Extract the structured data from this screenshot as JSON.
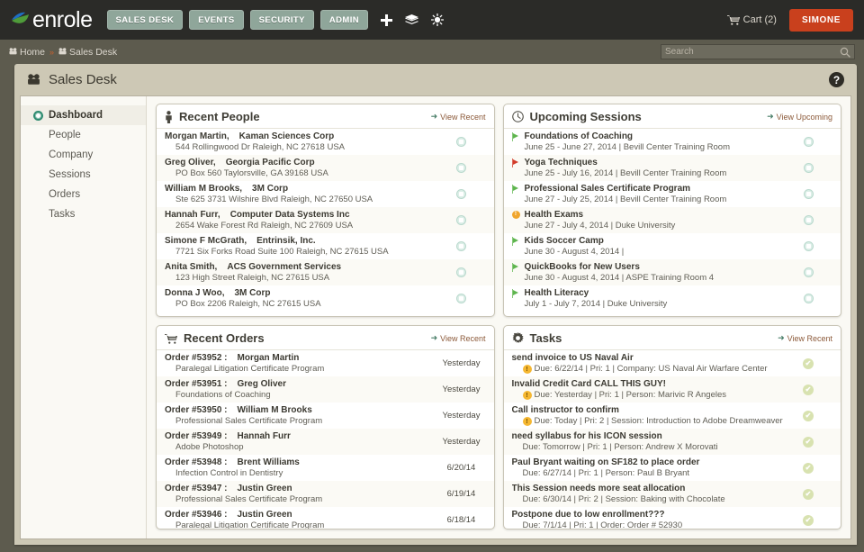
{
  "brand": {
    "name": "enrole",
    "accent": "#8fa69a",
    "user_accent": "#c9401d"
  },
  "topnav": {
    "buttons": [
      {
        "label": "SALES DESK",
        "name": "sales-desk"
      },
      {
        "label": "EVENTS",
        "name": "events"
      },
      {
        "label": "SECURITY",
        "name": "security"
      },
      {
        "label": "ADMIN",
        "name": "admin"
      }
    ],
    "icons": [
      {
        "name": "plus-icon",
        "glyph": "+"
      },
      {
        "name": "layers-icon",
        "glyph": "layers"
      },
      {
        "name": "sun-icon",
        "glyph": "sun"
      }
    ],
    "cart_label": "Cart (2)",
    "user_label": "SIMONE"
  },
  "breadcrumb": {
    "items": [
      {
        "label": "Home"
      },
      {
        "label": "Sales Desk"
      }
    ],
    "separator": "»"
  },
  "search": {
    "value": "",
    "placeholder": "Search"
  },
  "page": {
    "title": "Sales Desk",
    "help_label": "?"
  },
  "sidebar": {
    "items": [
      {
        "label": "Dashboard",
        "active": true
      },
      {
        "label": "People",
        "active": false
      },
      {
        "label": "Company",
        "active": false
      },
      {
        "label": "Sessions",
        "active": false
      },
      {
        "label": "Orders",
        "active": false
      },
      {
        "label": "Tasks",
        "active": false
      }
    ]
  },
  "cards": {
    "recent_people": {
      "title": "Recent People",
      "icon": "person-icon",
      "link": "View Recent",
      "rows": [
        {
          "name": "Morgan Martin,",
          "company": "Kaman Sciences Corp",
          "address": "544 Rollingwood Dr Raleigh, NC 27618 USA"
        },
        {
          "name": "Greg Oliver,",
          "company": "Georgia Pacific Corp",
          "address": "PO Box 560 Taylorsville, GA 39168 USA"
        },
        {
          "name": "William M Brooks,",
          "company": "3M Corp",
          "address": "Ste 625 3731 Wilshire Blvd Raleigh, NC 27650 USA"
        },
        {
          "name": "Hannah Furr,",
          "company": "Computer Data Systems Inc",
          "address": "2654 Wake Forest Rd Raleigh, NC 27609 USA"
        },
        {
          "name": "Simone F McGrath,",
          "company": "Entrinsik, Inc.",
          "address": "7721 Six Forks Road Suite 100 Raleigh, NC 27615 USA"
        },
        {
          "name": "Anita Smith,",
          "company": "ACS Government Services",
          "address": "123 High Street Raleigh, NC 27615 USA"
        },
        {
          "name": "Donna J Woo,",
          "company": "3M Corp",
          "address": "PO Box 2206 Raleigh, NC 27615 USA"
        }
      ]
    },
    "upcoming_sessions": {
      "title": "Upcoming Sessions",
      "icon": "clock-icon",
      "link": "View Upcoming",
      "rows": [
        {
          "name": "Foundations of Coaching",
          "detail": "June 25 - June 27, 2014 | Bevill Center Training Room",
          "status": "green-flag"
        },
        {
          "name": "Yoga Techniques",
          "detail": "June 25 - July 16, 2014 | Bevill Center Training Room",
          "status": "red-flag"
        },
        {
          "name": "Professional Sales Certificate Program",
          "detail": "June 27 - July 25, 2014 | Bevill Center Training Room",
          "status": "green-flag"
        },
        {
          "name": "Health Exams",
          "detail": "June 27 - July 4, 2014 | Duke University",
          "status": "orange-dot"
        },
        {
          "name": "Kids Soccer Camp",
          "detail": "June 30 - August 4, 2014 |",
          "status": "green-flag"
        },
        {
          "name": "QuickBooks for New Users",
          "detail": "June 30 - August 4, 2014 | ASPE Training Room 4",
          "status": "green-flag"
        },
        {
          "name": "Health Literacy",
          "detail": "July 1 - July 7, 2014 | Duke University",
          "status": "green-flag"
        }
      ]
    },
    "recent_orders": {
      "title": "Recent Orders",
      "icon": "cart-icon",
      "link": "View Recent",
      "rows": [
        {
          "order": "Order #53952 :",
          "person": "Morgan Martin",
          "program": "Paralegal Litigation Certificate Program",
          "date": "Yesterday"
        },
        {
          "order": "Order #53951 :",
          "person": "Greg Oliver",
          "program": "Foundations of Coaching",
          "date": "Yesterday"
        },
        {
          "order": "Order #53950 :",
          "person": "William M Brooks",
          "program": "Professional Sales Certificate Program",
          "date": "Yesterday"
        },
        {
          "order": "Order #53949 :",
          "person": "Hannah Furr",
          "program": "Adobe Photoshop",
          "date": "Yesterday"
        },
        {
          "order": "Order #53948 :",
          "person": "Brent Williams",
          "program": "Infection Control in Dentistry",
          "date": "6/20/14"
        },
        {
          "order": "Order #53947 :",
          "person": "Justin Green",
          "program": "Professional Sales Certificate Program",
          "date": "6/19/14"
        },
        {
          "order": "Order #53946 :",
          "person": "Justin Green",
          "program": "Paralegal Litigation Certificate Program",
          "date": "6/18/14"
        }
      ]
    },
    "tasks": {
      "title": "Tasks",
      "icon": "gear-icon",
      "link": "View Recent",
      "rows": [
        {
          "name": "send invoice to US Naval Air",
          "meta": "Due: 6/22/14  |  Pri: 1  |  Company: US Naval Air Warfare Center",
          "warn": true
        },
        {
          "name": "Invalid Credit Card CALL THIS GUY!",
          "meta": "Due: Yesterday  |  Pri: 1  |  Person: Marivic R Angeles",
          "warn": true
        },
        {
          "name": "Call instructor to confirm",
          "meta": "Due: Today  |  Pri: 2  |  Session: Introduction to Adobe Dreamweaver",
          "warn": true
        },
        {
          "name": "need syllabus for his ICON session",
          "meta": "Due: Tomorrow  |  Pri: 1  |  Person: Andrew X Morovati",
          "warn": false
        },
        {
          "name": "Paul Bryant waiting on SF182 to place order",
          "meta": "Due: 6/27/14  |  Pri: 1  |  Person: Paul B Bryant",
          "warn": false
        },
        {
          "name": "This Session needs more seat allocation",
          "meta": "Due: 6/30/14  |  Pri: 2  |  Session: Baking with Chocolate",
          "warn": false
        },
        {
          "name": "Postpone due to low enrollment???",
          "meta": "Due: 7/1/14  |  Pri: 1  |  Order: Order # 52930",
          "warn": false
        }
      ]
    }
  }
}
